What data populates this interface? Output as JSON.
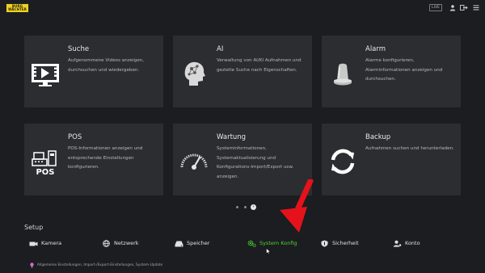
{
  "brand": {
    "logo_line1": "BURG",
    "logo_line2": "WÄCHTER"
  },
  "topbar": {
    "live_label": "LIVE",
    "icons": [
      "user-icon",
      "logout-icon",
      "menu-icon"
    ]
  },
  "tiles": [
    {
      "title": "Suche",
      "description": "Aufgenommene Videos anzeigen, durchsuchen und wiedergeben.",
      "icon": "playback-film-icon"
    },
    {
      "title": "AI",
      "description": "Verwaltung von AI/KI Aufnahmen und gezielte Suche nach Eigenschaften.",
      "icon": "ai-head-icon"
    },
    {
      "title": "Alarm",
      "description": "Alarme konfigurieren, Alarminformationen anzeigen und durchsuchen.",
      "icon": "alarm-siren-icon"
    },
    {
      "title": "POS",
      "description": "POS-Informationen anzeigen und entsprechende Einstellungen konfigurieren.",
      "icon": "pos-register-icon",
      "icon_text": "POS"
    },
    {
      "title": "Wartung",
      "description": "Systeminformationen, Systemaktualisierung und Konfigurations-Import/Export usw. anzeigen.",
      "icon": "gauge-icon"
    },
    {
      "title": "Backup",
      "description": "Aufnahmen suchen und herunterladen.",
      "icon": "sync-arrows-icon"
    }
  ],
  "pager": {
    "pages": 2,
    "current": 1,
    "next_icon": "chevron-right-icon",
    "next_glyph": "›"
  },
  "setup": {
    "title": "Setup",
    "items": [
      {
        "label": "Kamera",
        "icon": "camera-icon",
        "active": false
      },
      {
        "label": "Netzwerk",
        "icon": "globe-icon",
        "active": false
      },
      {
        "label": "Speicher",
        "icon": "hdd-icon",
        "active": false
      },
      {
        "label": "System Konfig",
        "icon": "gears-icon",
        "active": true
      },
      {
        "label": "Sicherheit",
        "icon": "shield-icon",
        "active": false
      },
      {
        "label": "Konto",
        "icon": "account-icon",
        "active": false
      }
    ]
  },
  "footer": {
    "text": "Allgemeine Einstellungen, Import-/Export-Einstellungen, System-Update",
    "icon": "lightbulb-icon"
  },
  "overlay": {
    "annotation": "red-arrow-pointing-down",
    "cursor": "mouse-pointer-icon"
  },
  "colors": {
    "background": "#1b1d21",
    "tile": "#2b2d31",
    "active": "#52d234",
    "annotation_arrow": "#e5121b",
    "logo": "#f2d21c"
  }
}
